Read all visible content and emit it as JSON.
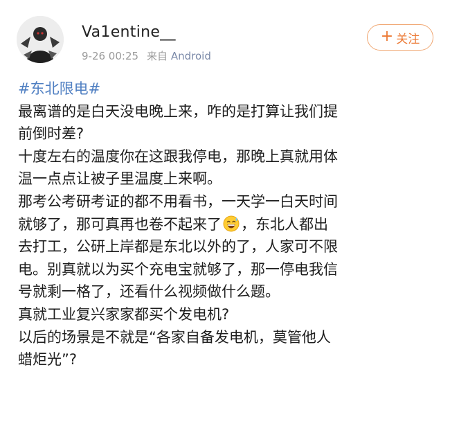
{
  "post": {
    "author": {
      "name": "Va1entine__"
    },
    "time": "9-26 00:25",
    "source_prefix": "来自",
    "source_app": "Android",
    "follow_button": {
      "label": "关注",
      "icon": "plus-icon"
    },
    "hashtag": "#东北限电#",
    "lines": [
      "最离谱的是白天没电晚上来，咋的是打算让我们提",
      "前倒时差?",
      "十度左右的温度你在这跟我停电，那晚上真就用体",
      "温一点点让被子里温度上来啊。",
      "那考公考研考证的都不用看书，一天学一白天时间"
    ],
    "line_with_emoji": {
      "before": "就够了，那可真再也卷不起来了",
      "emoji": "grinning-sweat-emoji",
      "after": "，东北人都出"
    },
    "lines_after": [
      "去打工，公研上岸都是东北以外的了，人家可不限",
      "电。别真就以为买个充电宝就够了，那一停电我信",
      "号就剩一格了，还看什么视频做什么题。",
      "真就工业复兴家家都买个发电机?",
      "以后的场景是不就是“各家自备发电机，莫管他人",
      "蜡炬光”?"
    ]
  },
  "colors": {
    "hashtag": "#4f7fc2",
    "follow_accent": "#ec7a36",
    "meta_gray": "#9a9a9a",
    "text": "#1e1e1e"
  }
}
